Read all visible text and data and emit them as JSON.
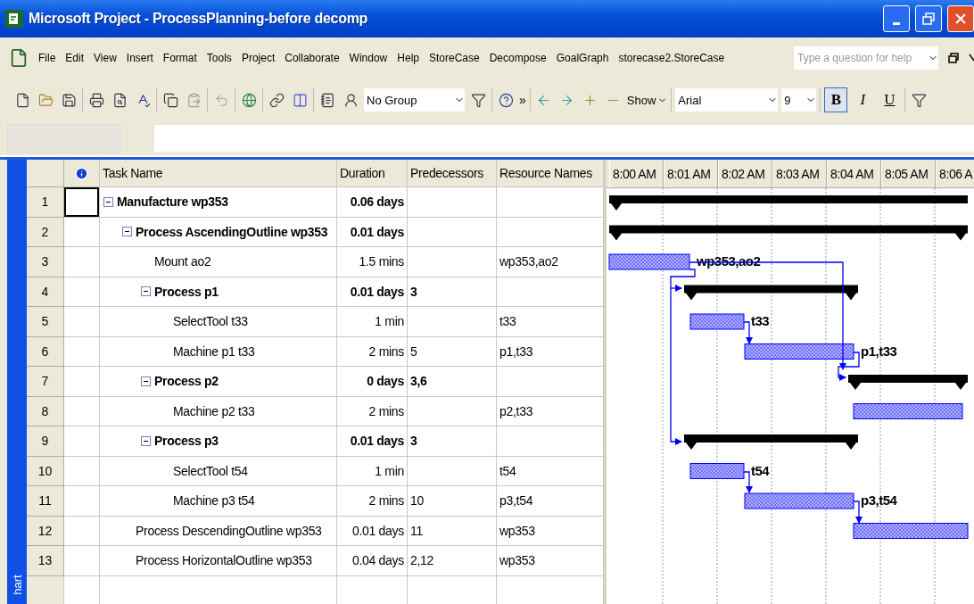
{
  "window": {
    "title": "Microsoft Project - ProcessPlanning-before decomp"
  },
  "menu_bar": {
    "items": [
      "File",
      "Edit",
      "View",
      "Insert",
      "Format",
      "Tools",
      "Project",
      "Collaborate",
      "Window",
      "Help",
      "StoreCase",
      "Decompose",
      "GoalGraph",
      "storecase2.StoreCase"
    ],
    "help_placeholder": "Type a question for help"
  },
  "toolbar": {
    "group": "No Group",
    "more": "»",
    "show": "Show",
    "font": "Arial",
    "font_size": "9",
    "format_buttons": [
      {
        "label": "B",
        "selected": true
      },
      {
        "label": "I",
        "selected": false
      },
      {
        "label": "U",
        "selected": false
      }
    ]
  },
  "view_bar": {
    "label": "hart"
  },
  "table": {
    "columns": [
      "Task Name",
      "Duration",
      "Predecessors",
      "Resource Names"
    ],
    "tasks": [
      {
        "id": "1",
        "name": "Manufacture wp353",
        "duration": "0.06 days",
        "summary": true,
        "expanded": true,
        "selected": true,
        "bar": {
          "kind": "summary"
        },
        "children": [
          {
            "id": "2",
            "name": "Process AscendingOutline wp353",
            "duration": "0.01 days",
            "summary": true,
            "expanded": true,
            "selected": false,
            "bar": {
              "kind": "summary"
            },
            "children": [
              {
                "id": "3",
                "name": "Mount ao2",
                "duration": "1.5 mins",
                "resources": "wp353,ao2",
                "summary": false,
                "selected": false,
                "bar": {
                  "kind": "task",
                  "label": "wp353,ao2"
                }
              },
              {
                "id": "4",
                "name": "Process p1",
                "duration": "0.01 days",
                "predecessors": "3",
                "summary": true,
                "expanded": true,
                "selected": false,
                "bar": {
                  "kind": "summary"
                },
                "children": [
                  {
                    "id": "5",
                    "name": "SelectTool t33",
                    "duration": "1 min",
                    "resources": "t33",
                    "summary": false,
                    "selected": false,
                    "bar": {
                      "kind": "task",
                      "label": "t33"
                    }
                  },
                  {
                    "id": "6",
                    "name": "Machine p1 t33",
                    "duration": "2 mins",
                    "predecessors": "5",
                    "resources": "p1,t33",
                    "summary": false,
                    "selected": false,
                    "bar": {
                      "kind": "task",
                      "label": "p1,t33"
                    }
                  }
                ]
              },
              {
                "id": "7",
                "name": "Process p2",
                "duration": "0 days",
                "predecessors": "3,6",
                "summary": true,
                "expanded": true,
                "selected": false,
                "bar": {
                  "kind": "summary"
                },
                "children": [
                  {
                    "id": "8",
                    "name": "Machine p2 t33",
                    "duration": "2 mins",
                    "resources": "p2,t33",
                    "summary": false,
                    "selected": false,
                    "bar": {
                      "kind": "task"
                    }
                  }
                ]
              },
              {
                "id": "9",
                "name": "Process p3",
                "duration": "0.01 days",
                "predecessors": "3",
                "summary": true,
                "expanded": true,
                "selected": false,
                "bar": {
                  "kind": "summary"
                },
                "children": [
                  {
                    "id": "10",
                    "name": "SelectTool t54",
                    "duration": "1 min",
                    "resources": "t54",
                    "summary": false,
                    "selected": false,
                    "bar": {
                      "kind": "task",
                      "label": "t54"
                    }
                  },
                  {
                    "id": "11",
                    "name": "Machine p3 t54",
                    "duration": "2 mins",
                    "predecessors": "10",
                    "resources": "p3,t54",
                    "summary": false,
                    "selected": false,
                    "bar": {
                      "kind": "task",
                      "label": "p3,t54"
                    }
                  }
                ]
              }
            ]
          },
          {
            "id": "12",
            "name": "Process DescendingOutline wp353",
            "duration": "0.01 days",
            "predecessors": "11",
            "resources": "wp353",
            "summary": false,
            "selected": false,
            "bar": {
              "kind": "task"
            }
          },
          {
            "id": "13",
            "name": "Process HorizontalOutline wp353",
            "duration": "0.04 days",
            "predecessors": "2,12",
            "resources": "wp353",
            "summary": false,
            "selected": false
          }
        ]
      }
    ]
  },
  "gantt": {
    "timescale": [
      "8:00 AM",
      "8:01 AM",
      "8:02 AM",
      "8:03 AM",
      "8:04 AM",
      "8:05 AM",
      "8:06 A"
    ]
  }
}
